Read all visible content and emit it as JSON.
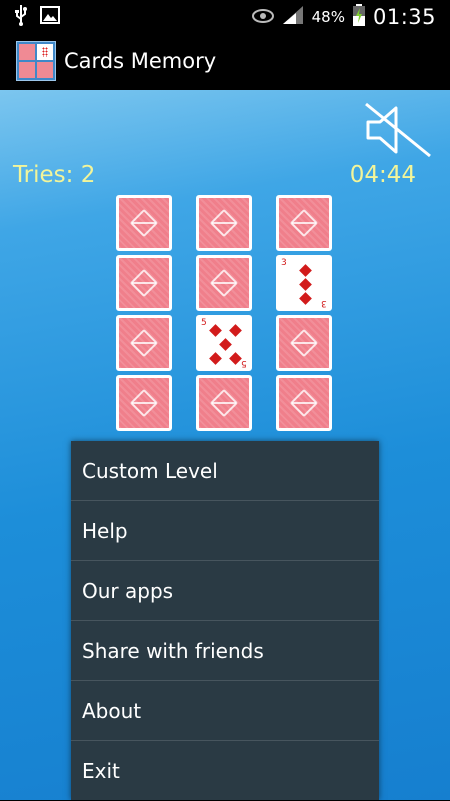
{
  "status_bar": {
    "battery_percent": "48%",
    "time": "01:35",
    "icons": [
      "usb-icon",
      "image-icon",
      "eye-icon",
      "signal-icon",
      "battery-charging-icon"
    ]
  },
  "action_bar": {
    "title": "Cards Memory",
    "icon": "app-icon"
  },
  "game": {
    "tries_label": "Tries: 2",
    "timer": "04:44",
    "sound_button_icon": "sound-muted-icon",
    "colors": {
      "text": "#f2f59a",
      "card_back": "#f07f8b",
      "suit": "#d21b1b"
    },
    "cards": [
      {
        "state": "back"
      },
      {
        "state": "back"
      },
      {
        "state": "back"
      },
      {
        "state": "back"
      },
      {
        "state": "back"
      },
      {
        "state": "face",
        "rank": "3",
        "suit": "diamonds"
      },
      {
        "state": "back"
      },
      {
        "state": "face",
        "rank": "5",
        "suit": "diamonds"
      },
      {
        "state": "back"
      },
      {
        "state": "back"
      },
      {
        "state": "back"
      },
      {
        "state": "back"
      }
    ]
  },
  "menu": {
    "items": [
      {
        "label": "Custom Level"
      },
      {
        "label": "Help"
      },
      {
        "label": "Our apps"
      },
      {
        "label": "Share with friends"
      },
      {
        "label": "About"
      },
      {
        "label": "Exit"
      }
    ]
  }
}
